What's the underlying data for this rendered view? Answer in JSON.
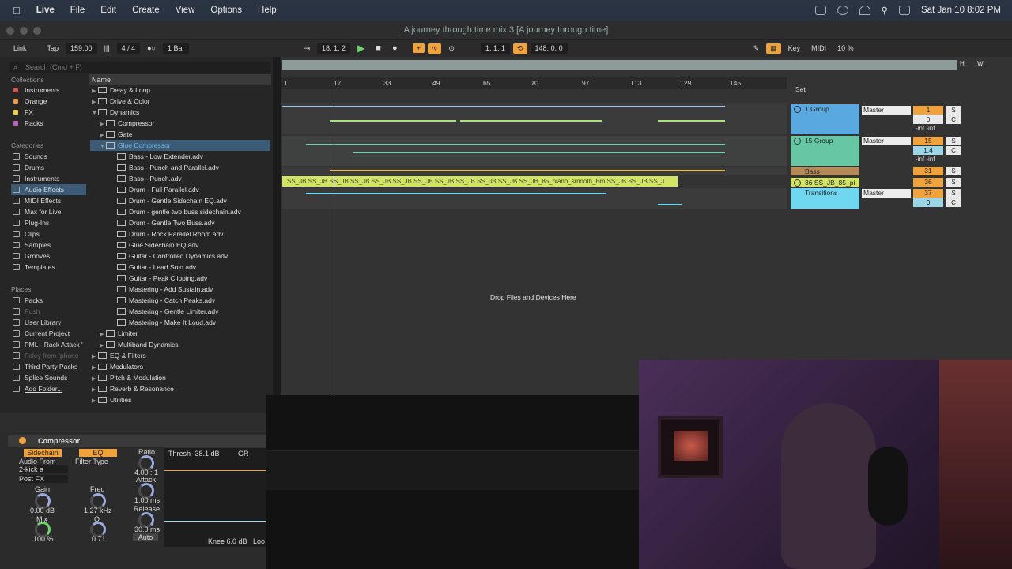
{
  "menubar": {
    "apple": "",
    "app": "Live",
    "items": [
      "File",
      "Edit",
      "Create",
      "View",
      "Options",
      "Help"
    ],
    "clock": "Sat Jan 10  8:02 PM"
  },
  "window": {
    "title": "A journey through time mix 3  [A journey through time]"
  },
  "transport": {
    "link": "Link",
    "tap": "Tap",
    "tempo": "159.00",
    "signature": "4 / 4",
    "quantize": "1 Bar",
    "position": "18.  1.  2",
    "loop_start": "1.  1.  1",
    "loop_length": "148.  0.  0",
    "key": "Key",
    "midi": "MIDI",
    "cpu": "10 %"
  },
  "browser": {
    "search_placeholder": "Search (Cmd + F)",
    "collections_label": "Collections",
    "collections": [
      {
        "label": "Instruments",
        "color": "#e05050"
      },
      {
        "label": "Orange",
        "color": "#f09a3a"
      },
      {
        "label": "FX",
        "color": "#f0d040"
      },
      {
        "label": "Racks",
        "color": "#c060c0"
      }
    ],
    "categories_label": "Categories",
    "categories": [
      "Sounds",
      "Drums",
      "Instruments",
      "Audio Effects",
      "MIDI Effects",
      "Max for Live",
      "Plug-Ins",
      "Clips",
      "Samples",
      "Grooves",
      "Templates"
    ],
    "places_label": "Places",
    "places": [
      "Packs",
      "Push",
      "User Library",
      "Current Project",
      "PML - Rack Attack '",
      "Foley from Iphone",
      "Third Party Packs",
      "Splice Sounds",
      "Add Folder..."
    ],
    "name_header": "Name",
    "tree": [
      "Delay & Loop",
      "Drive & Color",
      "Dynamics",
      "Compressor",
      "Gate",
      "Glue Compressor",
      "Bass - Low Extender.adv",
      "Bass - Punch and Parallel.adv",
      "Bass - Punch.adv",
      "Drum - Full Parallel.adv",
      "Drum - Gentle Sidechain EQ.adv",
      "Drum - gentle two buss sidechain.adv",
      "Drum - Gentle Two Buss.adv",
      "Drum - Rock Parallel Room.adv",
      "Glue Sidechain EQ.adv",
      "Guitar - Controlled Dynamics.adv",
      "Guitar - Lead Solo.adv",
      "Guitar - Peak Clipping.adv",
      "Mastering - Add Sustain.adv",
      "Mastering - Catch Peaks.adv",
      "Mastering - Gentle Limiter.adv",
      "Mastering - Make It Loud.adv",
      "Limiter",
      "Multiband Dynamics",
      "EQ & Filters",
      "Modulators",
      "Pitch & Modulation",
      "Reverb & Resonance",
      "Utilities"
    ]
  },
  "arrangement": {
    "ruler": [
      "1",
      "17",
      "33",
      "49",
      "65",
      "81",
      "97",
      "113",
      "129",
      "145"
    ],
    "clip_text": "SS_JB  SS_JB  SS_JB  SS_JB  SS_JB  SS_JB  SS_JB  SS_JB  SS_JB  SS_JB  SS_JB  SS_JB_85_piano_smooth_Bm  SS_JB  SS_JB   SS_J",
    "drop_text": "Drop Files and Devices Here",
    "set_label": "Set"
  },
  "tracks": [
    {
      "name": "1 Group",
      "color": "#5aa8e0",
      "route": "Master",
      "num": "1",
      "vol": "0",
      "pan": "C",
      "inf": "-inf   -inf"
    },
    {
      "name": "15 Group",
      "color": "#67c7a4",
      "route": "Master",
      "num": "15",
      "vol": "1.4",
      "pan": "C",
      "inf": "-inf   -inf"
    },
    {
      "name": "Bass",
      "color": "#b48a5a",
      "num": "31"
    },
    {
      "name": "36 SS_JB_85_pi",
      "color": "#d3e465",
      "num": "36"
    },
    {
      "name": "Transitions",
      "color": "#6fd7f0",
      "route": "Master",
      "num": "37",
      "vol": "0",
      "pan": "C"
    }
  ],
  "device": {
    "name": "Compressor",
    "sidechain": "Sidechain",
    "eq": "EQ",
    "audio_from": "Audio From",
    "source": "2-kick a",
    "postfx": "Post FX",
    "filter_type": "Filter Type",
    "gain_label": "Gain",
    "gain": "0.00 dB",
    "freq_label": "Freq",
    "freq": "1.27 kHz",
    "mix_label": "Mix",
    "mix": "100 %",
    "q_label": "Q",
    "q": "0.71",
    "ratio_label": "Ratio",
    "ratio": "4.00 : 1",
    "attack_label": "Attack",
    "attack": "1.00 ms",
    "release_label": "Release",
    "release": "30.0 ms",
    "auto": "Auto",
    "thresh": "Thresh -38.1 dB",
    "gr": "GR",
    "knee": "Knee 6.0 dB",
    "look": "Loo"
  }
}
